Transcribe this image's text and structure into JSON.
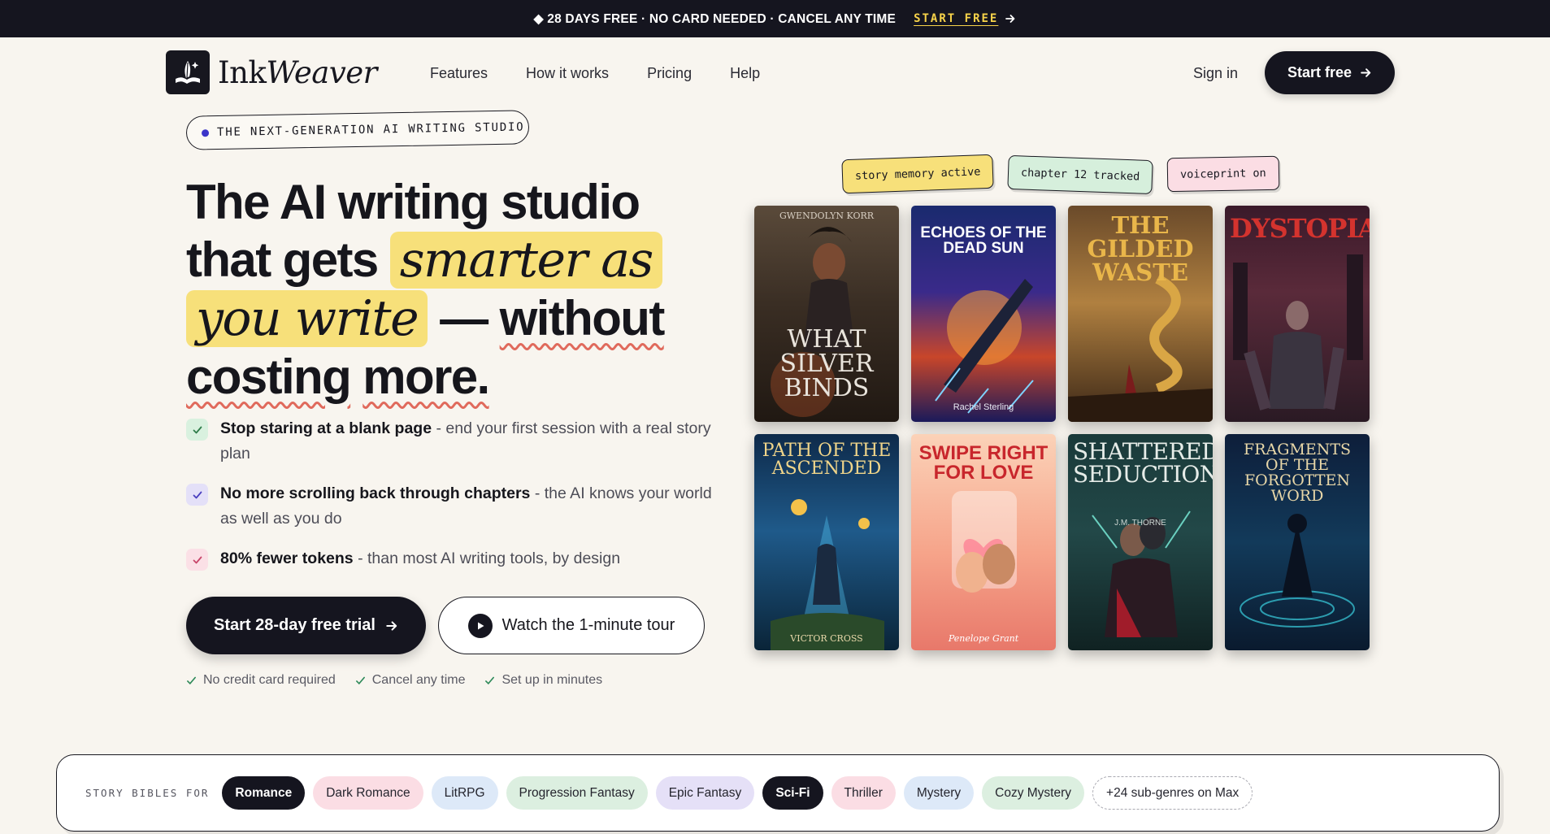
{
  "banner": {
    "message": "◆ 28 DAYS FREE · NO CARD NEEDED · CANCEL ANY TIME",
    "cta": "START FREE"
  },
  "brand": {
    "name_plain": "Ink",
    "name_italic": "Weaver"
  },
  "nav": {
    "links": [
      "Features",
      "How it works",
      "Pricing",
      "Help"
    ],
    "sign_in": "Sign in",
    "start_free": "Start free"
  },
  "hero": {
    "eyebrow": "THE NEXT-GENERATION AI WRITING STUDIO",
    "headline": {
      "line1": "The AI writing studio",
      "line2_pre": "that gets",
      "highlight1": "smarter as",
      "highlight2": "you write",
      "dash": "—",
      "without": "without",
      "costing": "costing",
      "more": "more."
    },
    "bullets": [
      {
        "bold": "Stop staring at a blank page",
        "rest": " - end your first session with a real story plan",
        "color": "#d9f1df"
      },
      {
        "bold": "No more scrolling back through chapters",
        "rest": " - the AI knows your world as well as you do",
        "color": "#e4e0f8"
      },
      {
        "bold": "80% fewer tokens",
        "rest": " - than most AI writing tools, by design",
        "color": "#fbe0e6"
      }
    ],
    "cta_primary": "Start 28-day free trial",
    "cta_secondary": "Watch the 1-minute tour",
    "trust": [
      "No credit card required",
      "Cancel any time",
      "Set up in minutes"
    ]
  },
  "tags": [
    {
      "label": "story memory active",
      "color": "#f7e07a"
    },
    {
      "label": "chapter 12 tracked",
      "color": "#d6efdc"
    },
    {
      "label": "voiceprint on",
      "color": "#fbdde4"
    }
  ],
  "books": [
    {
      "title": "WHAT SILVER BINDS",
      "author": "GWENDOLYN KORR"
    },
    {
      "title": "ECHOES OF THE DEAD SUN",
      "author": "Rachel Sterling"
    },
    {
      "title": "THE GILDED WASTE",
      "author": ""
    },
    {
      "title": "DYSTOPIA",
      "author": ""
    },
    {
      "title": "PATH OF THE ASCENDED",
      "author": "VICTOR CROSS"
    },
    {
      "title": "SWIPE RIGHT FOR LOVE",
      "author": "Penelope Grant"
    },
    {
      "title": "SHATTERED SEDUCTION",
      "author": "J.M. THORNE"
    },
    {
      "title": "FRAGMENTS OF THE FORGOTTEN WORD",
      "author": ""
    }
  ],
  "genres": {
    "label": "STORY BIBLES FOR",
    "chips": [
      {
        "label": "Romance",
        "bg": "#15151f",
        "fg": "#ffffff"
      },
      {
        "label": "Dark Romance",
        "bg": "#fbdde4",
        "fg": "#25252e"
      },
      {
        "label": "LitRPG",
        "bg": "#dde9f8",
        "fg": "#25252e"
      },
      {
        "label": "Progression Fantasy",
        "bg": "#dcefe0",
        "fg": "#25252e"
      },
      {
        "label": "Epic Fantasy",
        "bg": "#e5e0f7",
        "fg": "#25252e"
      },
      {
        "label": "Sci-Fi",
        "bg": "#15151f",
        "fg": "#ffffff"
      },
      {
        "label": "Thriller",
        "bg": "#fbdde4",
        "fg": "#25252e"
      },
      {
        "label": "Mystery",
        "bg": "#dde9f8",
        "fg": "#25252e"
      },
      {
        "label": "Cozy Mystery",
        "bg": "#dcefe0",
        "fg": "#25252e"
      }
    ],
    "more": "+24 sub-genres on Max"
  }
}
